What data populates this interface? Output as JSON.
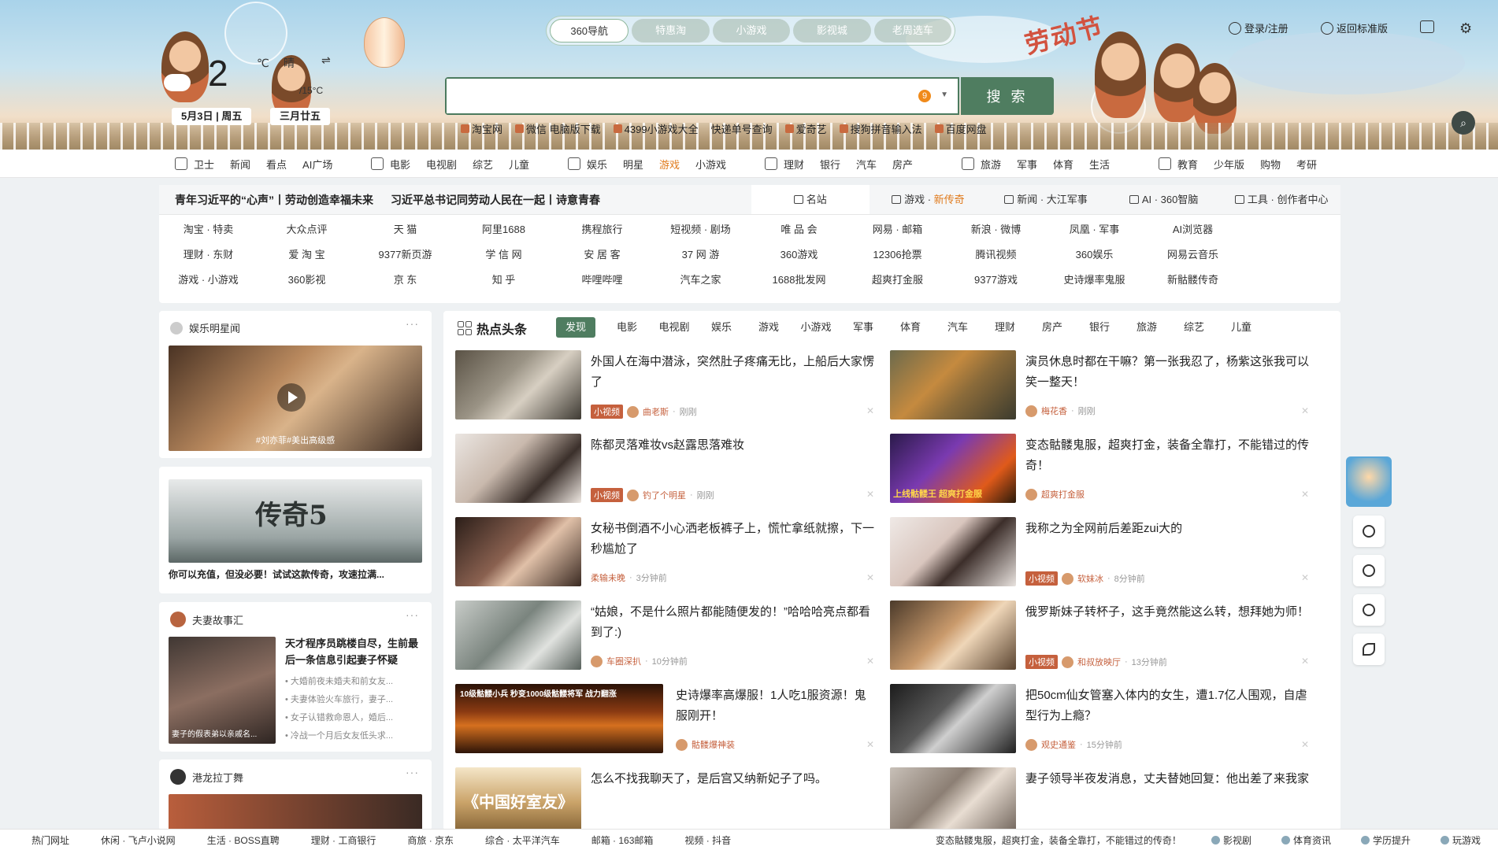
{
  "weather": {
    "temp": "2",
    "unit": "℃",
    "type": "晴",
    "range": "/15°C",
    "swap": "⇌"
  },
  "date": {
    "solar": "5月3日 | 周五",
    "lunar": "三月廿五"
  },
  "festival_title": "劳动节",
  "top_tabs": [
    "360导航",
    "特惠淘",
    "小游戏",
    "影视城",
    "老周选车"
  ],
  "search": {
    "placeholder": "",
    "badge": "9",
    "button": "搜 索"
  },
  "quick_links": [
    "淘宝网",
    "微信 电脑版下载",
    "4399小游戏大全",
    "快递单号查询",
    "爱奇艺",
    "搜狗拼音输入法",
    "百度网盘"
  ],
  "header_right": {
    "login": "登录/注册",
    "back": "返回标准版"
  },
  "catnav": [
    [
      "卫士",
      "新闻",
      "看点",
      "AI广场"
    ],
    [
      "电影",
      "电视剧",
      "综艺",
      "儿童"
    ],
    [
      "娱乐",
      "明星",
      "游戏",
      "小游戏"
    ],
    [
      "理财",
      "银行",
      "汽车",
      "房产"
    ],
    [
      "旅游",
      "军事",
      "体育",
      "生活"
    ],
    [
      "教育",
      "少年版",
      "购物",
      "考研"
    ]
  ],
  "headlines": [
    "青年习近平的“心声”丨劳动创造幸福未来",
    "习近平总书记同劳动人民在一起丨诗意青春"
  ],
  "site_tabs": [
    {
      "label": "名站",
      "extra": ""
    },
    {
      "label": "游戏 · ",
      "extra": "新传奇"
    },
    {
      "label": "新闻 · 大江军事",
      "extra": ""
    },
    {
      "label": "AI · 360智脑",
      "extra": ""
    },
    {
      "label": "工具 · 创作者中心",
      "extra": ""
    }
  ],
  "sites": [
    "淘宝 · 特卖",
    "大众点评",
    "天 猫",
    "阿里1688",
    "携程旅行",
    "短视频 · 剧场",
    "唯 品 会",
    "网易 · 邮箱",
    "新浪 · 微博",
    "凤凰 · 军事",
    "AI浏览器",
    "",
    "理财 · 东财",
    "爱 淘 宝",
    "9377新页游",
    "学 信 网",
    "安 居 客",
    "37 网 游",
    "360游戏",
    "12306抢票",
    "腾讯视频",
    "360娱乐",
    "网易云音乐",
    "",
    "游戏 · 小游戏",
    "360影视",
    "京 东",
    "知 乎",
    "哔哩哔哩",
    "汽车之家",
    "1688批发网",
    "超爽打金服",
    "9377游戏",
    "史诗爆率鬼服",
    "新骷髅传奇",
    ""
  ],
  "left": {
    "ent_title": "娱乐明星闻",
    "ent_caption": "#刘亦菲#美出高级感",
    "ad_title": "传奇5",
    "ad_text": "你可以充值，但没必要！试试这款传奇，攻速拉满...",
    "story_title": "夫妻故事汇",
    "story_headline": "天才程序员跳楼自尽，生前最后一条信息引起妻子怀疑",
    "story_caption": "妻子的假表弟以亲戚名...",
    "story_items": [
      "大婚前夜未婚夫和前女友...",
      "夫妻体验火车旅行，妻子...",
      "女子认错救命恩人，婚后...",
      "冷战一个月后女友低头求..."
    ],
    "dance_title": "港龙拉丁舞"
  },
  "feed": {
    "title": "热点头条",
    "tabs": [
      "发现",
      "电影",
      "电视剧",
      "娱乐",
      "游戏",
      "小游戏",
      "军事",
      "体育",
      "汽车",
      "理财",
      "房产",
      "银行",
      "旅游",
      "综艺",
      "儿童"
    ],
    "items": [
      {
        "title": "外国人在海中潜泳，突然肚子疼痛无比，上船后大家愣了",
        "tag": "小视频",
        "source": "曲老斯",
        "time": "刚刚"
      },
      {
        "title": "演员休息时都在干嘛？第一张我忍了，杨紫这张我可以笑一整天！",
        "tag": "",
        "source": "梅花香",
        "time": "刚刚"
      },
      {
        "title": "陈都灵落难妆vs赵露思落难妆",
        "tag": "小视频",
        "source": "钓了个明星",
        "time": "刚刚"
      },
      {
        "title": "变态骷髅鬼服，超爽打金，装备全靠打，不能错过的传奇！",
        "tag": "",
        "source": "超爽打金服",
        "time": ""
      },
      {
        "title": "女秘书倒酒不小心洒老板裤子上，慌忙拿纸就擦，下一秒尴尬了",
        "tag": "",
        "source": "柔输未晚",
        "time": "3分钟前"
      },
      {
        "title": "我称之为全网前后差距zui大的",
        "tag": "小视频",
        "source": "软妹冰",
        "time": "8分钟前"
      },
      {
        "title": "“姑娘，不是什么照片都能随便发的！”哈哈哈亮点都看到了:)",
        "tag": "",
        "source": "车圈深扒",
        "time": "10分钟前"
      },
      {
        "title": "俄罗斯妹子转杯子，这手竟然能这么转，想拜她为师！",
        "tag": "小视频",
        "source": "和叔放映厅",
        "time": "13分钟前"
      },
      {
        "title": "史诗爆率高爆服！1人吃1服资源！鬼服刚开！",
        "tag": "",
        "source": "骷髅爆神装",
        "time": ""
      },
      {
        "title": "把50cm仙女管塞入体内的女生，遭1.7亿人围观，自虐型行为上瘾？",
        "tag": "",
        "source": "观史通鉴",
        "time": "15分钟前"
      },
      {
        "title": "怎么不找我聊天了，是后宫又纳新妃子了吗。",
        "tag": "",
        "source": "",
        "time": ""
      },
      {
        "title": "妻子领导半夜发消息，丈夫替她回复：他出差了来我家",
        "tag": "",
        "source": "",
        "time": ""
      }
    ],
    "img_texts": {
      "banner1": "10级骷髅小兵 秒变1000级骷髅将军 战力翻涨",
      "banner2": "上线骷髅王 超爽打金服",
      "book": "《中国好室友》"
    }
  },
  "bottom_left": [
    "热门网址",
    "休闲 · 飞卢小说网",
    "生活 · BOSS直聘",
    "理财 · 工商银行",
    "商旅 · 京东",
    "综合 · 太平洋汽车",
    "邮箱 · 163邮箱",
    "视频 · 抖音"
  ],
  "bottom_right": [
    "变态骷髅鬼服，超爽打金，装备全靠打，不能错过的传奇！",
    "影视剧",
    "体育资讯",
    "学历提升",
    "玩游戏"
  ],
  "colors": {
    "accent": "#4f7d60",
    "hot": "#e07a1c",
    "tag": "#c5603d"
  }
}
